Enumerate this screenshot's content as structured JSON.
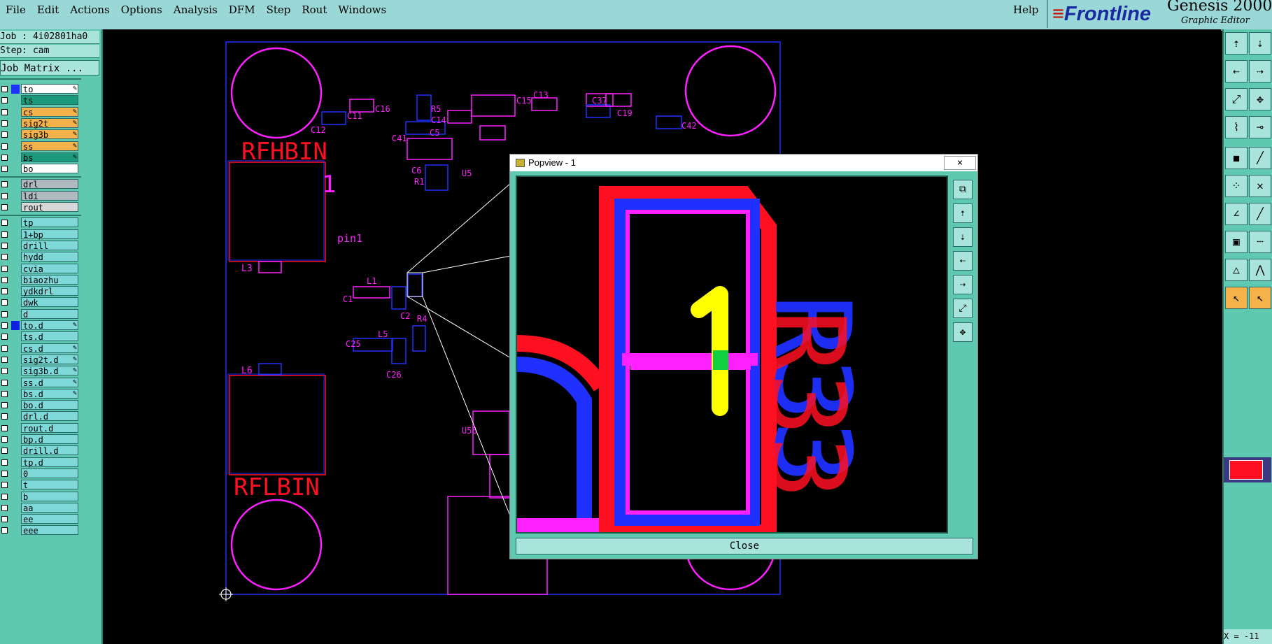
{
  "menubar": {
    "items": [
      "File",
      "Edit",
      "Actions",
      "Options",
      "Analysis",
      "DFM",
      "Step",
      "Rout",
      "Windows"
    ],
    "help": "Help"
  },
  "brand": {
    "logo": "Frontline",
    "product": "Genesis 2000 ™",
    "subtitle": "Graphic Editor"
  },
  "job": {
    "job_line": "Job : 4i02801ha0",
    "step_line": "Step: cam",
    "matrix_button": "Job Matrix ..."
  },
  "layers": [
    {
      "name": "to",
      "color": "#ffffff",
      "swatch": "#2030ff",
      "editable": true
    },
    {
      "name": "ts",
      "color": "#1a9a7a",
      "swatch": "",
      "editable": false
    },
    {
      "name": "cs",
      "color": "#f6b24a",
      "swatch": "",
      "editable": true
    },
    {
      "name": "sig2t",
      "color": "#f6b24a",
      "swatch": "",
      "editable": true
    },
    {
      "name": "sig3b",
      "color": "#f6b24a",
      "swatch": "",
      "editable": true
    },
    {
      "name": "ss",
      "color": "#f6b24a",
      "swatch": "",
      "editable": true
    },
    {
      "name": "bs",
      "color": "#1a9a7a",
      "swatch": "",
      "editable": true
    },
    {
      "name": "bo",
      "color": "#ffffff",
      "swatch": "",
      "editable": false
    },
    {
      "name": "drl",
      "color": "#b0b8c0",
      "swatch": "",
      "editable": false
    },
    {
      "name": "ldi",
      "color": "#b0b8c0",
      "swatch": "",
      "editable": false
    },
    {
      "name": "rout",
      "color": "#d8d8d8",
      "swatch": "",
      "editable": false
    },
    {
      "name": "tp",
      "color": "#7fd8d8",
      "swatch": "",
      "editable": false
    },
    {
      "name": "1+bp",
      "color": "#7fd8d8",
      "swatch": "",
      "editable": false
    },
    {
      "name": "drill",
      "color": "#7fd8d8",
      "swatch": "",
      "editable": false
    },
    {
      "name": "hydd",
      "color": "#7fd8d8",
      "swatch": "",
      "editable": false
    },
    {
      "name": "cvia",
      "color": "#7fd8d8",
      "swatch": "",
      "editable": false
    },
    {
      "name": "biaozhu",
      "color": "#7fd8d8",
      "swatch": "",
      "editable": false
    },
    {
      "name": "ydkdrl",
      "color": "#7fd8d8",
      "swatch": "",
      "editable": false
    },
    {
      "name": "dwk",
      "color": "#7fd8d8",
      "swatch": "",
      "editable": false
    },
    {
      "name": "d",
      "color": "#7fd8d8",
      "swatch": "",
      "editable": false
    },
    {
      "name": "to.d",
      "color": "#7fd8d8",
      "swatch": "#1020e0",
      "editable": true
    },
    {
      "name": "ts.d",
      "color": "#7fd8d8",
      "swatch": "",
      "editable": false
    },
    {
      "name": "cs.d",
      "color": "#7fd8d8",
      "swatch": "",
      "editable": true
    },
    {
      "name": "sig2t.d",
      "color": "#7fd8d8",
      "swatch": "",
      "editable": true
    },
    {
      "name": "sig3b.d",
      "color": "#7fd8d8",
      "swatch": "",
      "editable": true
    },
    {
      "name": "ss.d",
      "color": "#7fd8d8",
      "swatch": "",
      "editable": true
    },
    {
      "name": "bs.d",
      "color": "#7fd8d8",
      "swatch": "",
      "editable": true
    },
    {
      "name": "bo.d",
      "color": "#7fd8d8",
      "swatch": "",
      "editable": false
    },
    {
      "name": "drl.d",
      "color": "#7fd8d8",
      "swatch": "",
      "editable": false
    },
    {
      "name": "rout.d",
      "color": "#7fd8d8",
      "swatch": "",
      "editable": false
    },
    {
      "name": "bp.d",
      "color": "#7fd8d8",
      "swatch": "",
      "editable": false
    },
    {
      "name": "drill.d",
      "color": "#7fd8d8",
      "swatch": "",
      "editable": false
    },
    {
      "name": "tp.d",
      "color": "#7fd8d8",
      "swatch": "",
      "editable": false
    },
    {
      "name": "0",
      "color": "#7fd8d8",
      "swatch": "",
      "editable": false
    },
    {
      "name": "t",
      "color": "#7fd8d8",
      "swatch": "",
      "editable": false
    },
    {
      "name": "b",
      "color": "#7fd8d8",
      "swatch": "",
      "editable": false
    },
    {
      "name": "aa",
      "color": "#7fd8d8",
      "swatch": "",
      "editable": false
    },
    {
      "name": "ee",
      "color": "#7fd8d8",
      "swatch": "",
      "editable": false
    },
    {
      "name": "eee",
      "color": "#7fd8d8",
      "swatch": "",
      "editable": false
    }
  ],
  "board": {
    "labels": {
      "rfhbin": "RFHBIN",
      "rflbin": "RFLBIN",
      "pin1": "pin1",
      "one": "1",
      "l3": "L3",
      "l6": "L6",
      "l1": "L1",
      "l5": "L5",
      "c1": "C1",
      "c2": "C2",
      "c25": "C25",
      "c26": "C26",
      "c12": "C12",
      "c11": "C11",
      "c16": "C16",
      "r5": "R5",
      "c14": "C14",
      "c15": "C15",
      "c13": "C13",
      "c37": "C37",
      "c19": "C19",
      "c42": "C42",
      "c41": "C41",
      "c5": "C5",
      "c6": "C6",
      "r1": "R1",
      "u5": "U5",
      "u56": "U56",
      "r4": "R4"
    }
  },
  "popview": {
    "title": "Popview - 1",
    "close_icon": "×",
    "close_button": "Close",
    "digit": "1",
    "designator": "R33"
  },
  "coords": {
    "x_readout": "X = -11"
  },
  "colors": {
    "panel": "#5ec9b0",
    "menubar": "#9ad8d8",
    "board_magenta": "#ff20ff",
    "board_blue": "#2030ff",
    "board_red": "#ff1020"
  }
}
